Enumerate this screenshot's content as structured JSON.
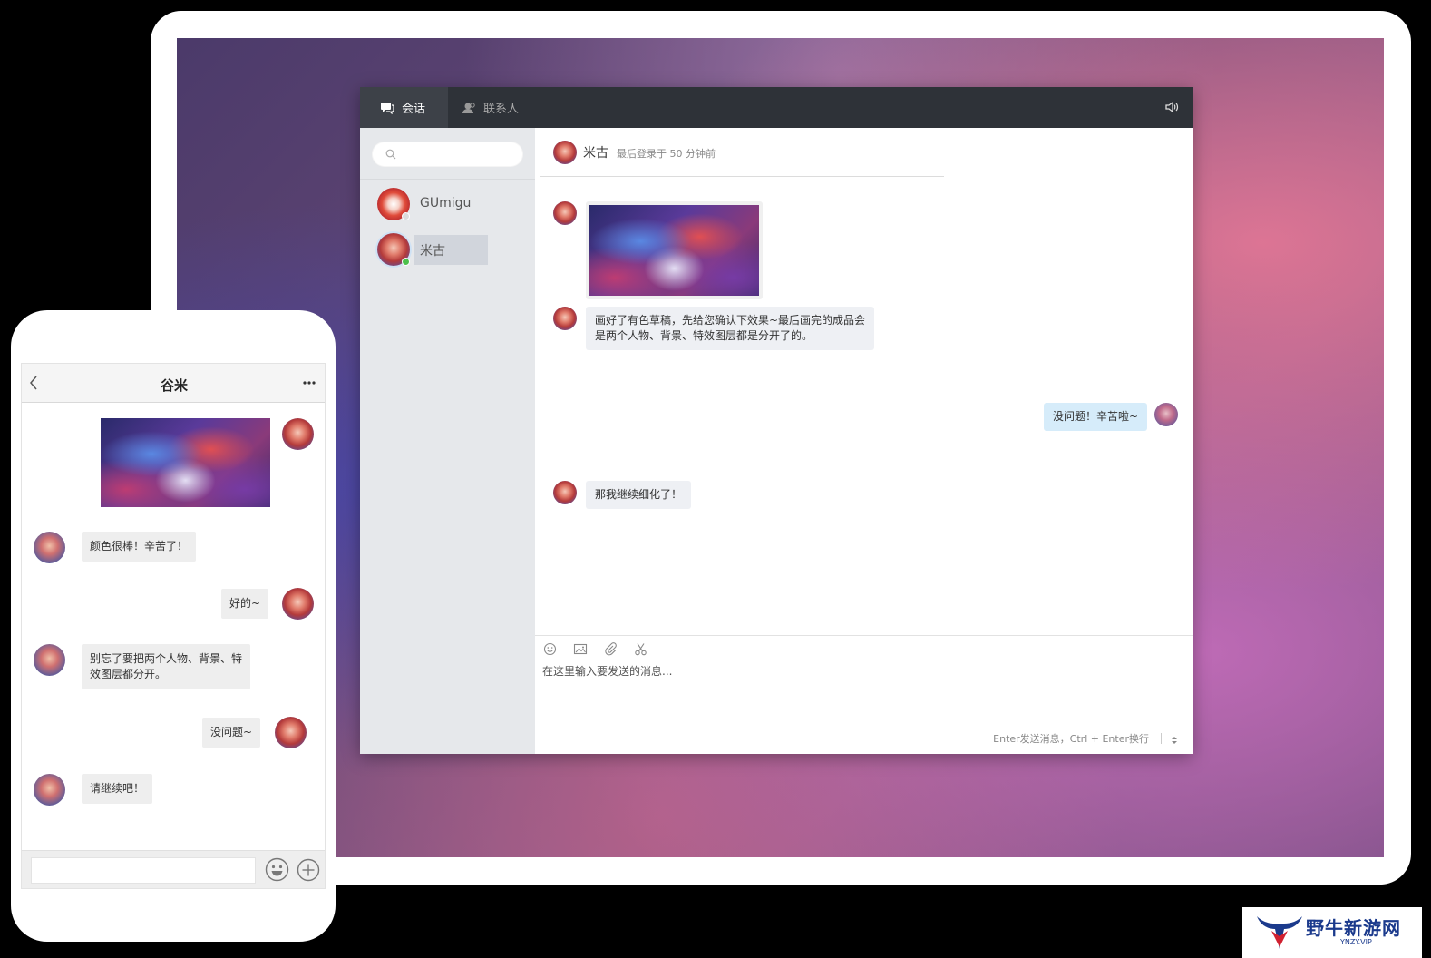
{
  "desktop": {
    "tabs": [
      {
        "label": "会话",
        "active": true
      },
      {
        "label": "联系人",
        "active": false
      }
    ],
    "search": {
      "placeholder": ""
    },
    "contacts": [
      {
        "name": "GUmigu",
        "online": false
      },
      {
        "name": "米古",
        "online": true,
        "selected": true
      }
    ],
    "chat_header": {
      "name": "米古",
      "status": "最后登录于  50 分钟前"
    },
    "messages": [
      {
        "from": "them",
        "type": "image"
      },
      {
        "from": "them",
        "type": "text",
        "lines": [
          "画好了有色草稿，先给您确认下效果~最后画完的成品会",
          "是两个人物、背景、特效图层都是分开了的。"
        ]
      },
      {
        "from": "me",
        "type": "text",
        "text": "没问题！辛苦啦~"
      },
      {
        "from": "them",
        "type": "text",
        "text": "那我继续细化了！"
      }
    ],
    "input": {
      "placeholder": "在这里输入要发送的消息..."
    },
    "send_hint": "Enter发送消息，Ctrl + Enter换行"
  },
  "phone": {
    "title": "谷米",
    "messages": [
      {
        "from": "me",
        "type": "image"
      },
      {
        "from": "them",
        "type": "text",
        "text": "颜色很棒！辛苦了！"
      },
      {
        "from": "me",
        "type": "text",
        "text": "好的~"
      },
      {
        "from": "them",
        "type": "text",
        "lines": [
          "别忘了要把两个人物、背景、特",
          "效图层都分开。"
        ]
      },
      {
        "from": "me",
        "type": "text",
        "text": "没问题~"
      },
      {
        "from": "them",
        "type": "text",
        "text": "请继续吧！"
      }
    ]
  },
  "watermark": {
    "text": "野牛新游网",
    "sub": "YNZY.VIP"
  },
  "colors": {
    "accent_me_bubble": "#d6ecfa",
    "window_bar": "#2e3238",
    "online": "#4cc04c"
  }
}
